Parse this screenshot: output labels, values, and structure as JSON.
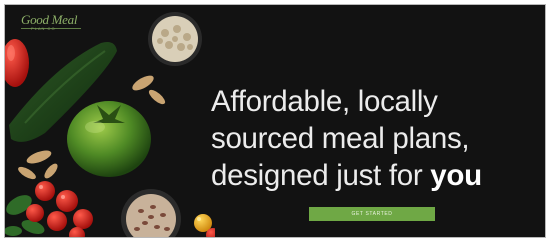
{
  "brand": {
    "logo_text": "Good Meal",
    "logo_tagline": "PLAN CO"
  },
  "hero": {
    "headline_line1": "Affordable, locally",
    "headline_line2": "sourced meal plans,",
    "headline_line3_prefix": "designed just for ",
    "headline_line3_emphasis": "you",
    "cta_label": "GET STARTED"
  },
  "colors": {
    "background": "#121212",
    "accent_green": "#6fa845",
    "headline_text": "#ececec"
  }
}
